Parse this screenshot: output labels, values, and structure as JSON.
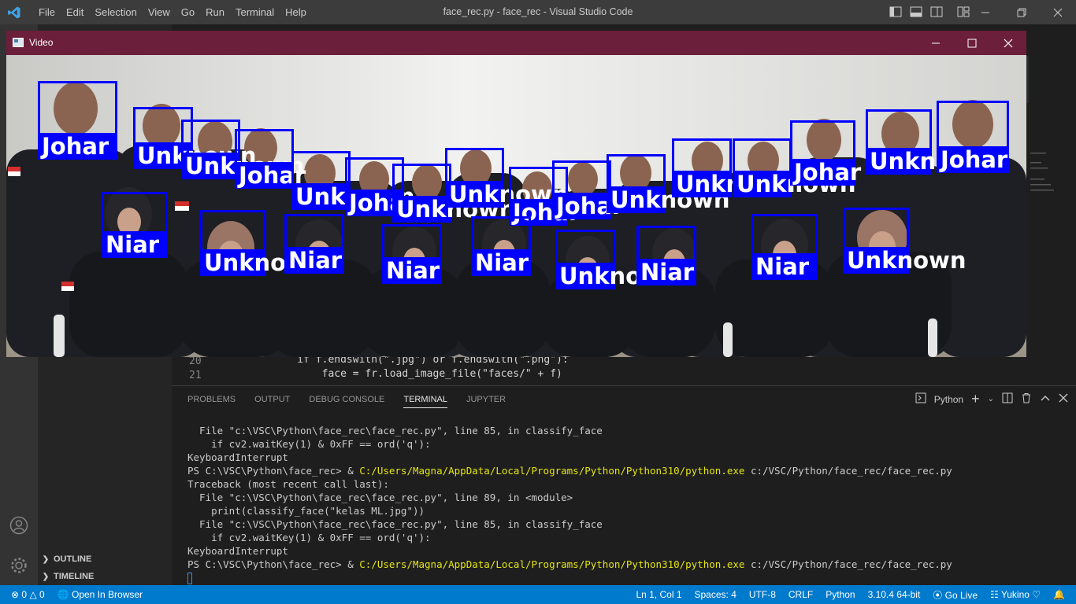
{
  "vscode": {
    "window_title": "face_rec.py - face_rec - Visual Studio Code",
    "menu": [
      "File",
      "Edit",
      "Selection",
      "View",
      "Go",
      "Run",
      "Terminal",
      "Help"
    ],
    "editor": {
      "lines": [
        {
          "num": "20",
          "code": "    if f.endswith(\".jpg\") or f.endswith(\".png\"):"
        },
        {
          "num": "21",
          "code": "        face = fr.load_image_file(\"faces/\" + f)"
        }
      ]
    },
    "sidebar": {
      "outline": "OUTLINE",
      "timeline": "TIMELINE"
    },
    "panel": {
      "tabs": [
        "PROBLEMS",
        "OUTPUT",
        "DEBUG CONSOLE",
        "TERMINAL",
        "JUPYTER"
      ],
      "active_tab": "TERMINAL",
      "terminal_profile": "Python",
      "terminal_lines": [
        {
          "text": "  File \"c:\\VSC\\Python\\face_rec\\face_rec.py\", line 85, in classify_face"
        },
        {
          "text": "    if cv2.waitKey(1) & 0xFF == ord('q'):"
        },
        {
          "text": "KeyboardInterrupt"
        },
        {
          "prompt": "PS C:\\VSC\\Python\\face_rec> & ",
          "exe": "C:/Users/Magna/AppData/Local/Programs/Python/Python310/python.exe",
          "arg": " c:/VSC/Python/face_rec/face_rec.py"
        },
        {
          "text": "Traceback (most recent call last):"
        },
        {
          "text": "  File \"c:\\VSC\\Python\\face_rec\\face_rec.py\", line 89, in <module>"
        },
        {
          "text": "    print(classify_face(\"kelas ML.jpg\"))"
        },
        {
          "text": "  File \"c:\\VSC\\Python\\face_rec\\face_rec.py\", line 85, in classify_face"
        },
        {
          "text": "    if cv2.waitKey(1) & 0xFF == ord('q'):"
        },
        {
          "text": "KeyboardInterrupt"
        },
        {
          "prompt": "PS C:\\VSC\\Python\\face_rec> & ",
          "exe": "C:/Users/Magna/AppData/Local/Programs/Python/Python310/python.exe",
          "arg": " c:/VSC/Python/face_rec/face_rec.py"
        }
      ]
    },
    "statusbar": {
      "errors": "0",
      "warnings": "0",
      "open_in_browser": "Open In Browser",
      "position": "Ln 1, Col 1",
      "spaces": "Spaces: 4",
      "encoding": "UTF-8",
      "eol": "CRLF",
      "language": "Python",
      "interpreter": "3.10.4 64-bit",
      "go_live": "Go Live",
      "user": "Yukino"
    },
    "colors": {
      "accent": "#007acc",
      "terminal_path": "#e5e510"
    }
  },
  "video_window": {
    "title": "Video",
    "faces": [
      {
        "name": "Johar"
      },
      {
        "name": "Unknown"
      },
      {
        "name": "Unknown"
      },
      {
        "name": "Johar"
      },
      {
        "name": "Unknown"
      },
      {
        "name": "Johar"
      },
      {
        "name": "Unknown"
      },
      {
        "name": "Unknown"
      },
      {
        "name": "Johar"
      },
      {
        "name": "Johar"
      },
      {
        "name": "Unknown"
      },
      {
        "name": "Unknown"
      },
      {
        "name": "Unknown"
      },
      {
        "name": "Johar"
      },
      {
        "name": "Unknown"
      },
      {
        "name": "Johar"
      },
      {
        "name": "Niar"
      },
      {
        "name": "Unknown"
      },
      {
        "name": "Niar"
      },
      {
        "name": "Niar"
      },
      {
        "name": "Niar"
      },
      {
        "name": "Unknown"
      },
      {
        "name": "Niar"
      },
      {
        "name": "Niar"
      },
      {
        "name": "Unknown"
      }
    ],
    "colors": {
      "box": "#0000ff",
      "label_text": "#ffffff",
      "titlebar": "#6b1f3b"
    }
  }
}
